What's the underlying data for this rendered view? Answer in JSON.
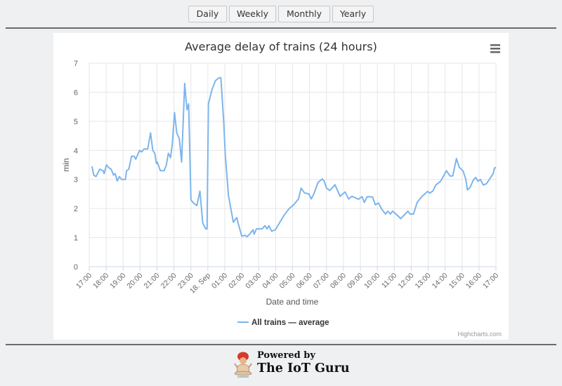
{
  "period_buttons": [
    {
      "label": "Daily"
    },
    {
      "label": "Weekly"
    },
    {
      "label": "Monthly"
    },
    {
      "label": "Yearly"
    }
  ],
  "chart_data": {
    "type": "line",
    "title": "Average delay of trains (24 hours)",
    "xlabel": "Date and time",
    "ylabel": "min",
    "ylim": [
      0,
      7
    ],
    "yticks": [
      "0",
      "1",
      "2",
      "3",
      "4",
      "5",
      "6",
      "7"
    ],
    "xticks": [
      "17:00",
      "18:00",
      "19:00",
      "20:00",
      "21:00",
      "22:00",
      "23:00",
      "18. Sep",
      "01:00",
      "02:00",
      "03:00",
      "04:00",
      "05:00",
      "06:00",
      "07:00",
      "08:00",
      "09:00",
      "10:00",
      "11:00",
      "12:00",
      "13:00",
      "14:00",
      "15:00",
      "16:00",
      "17:00"
    ],
    "grid": true,
    "legend_position": "bottom",
    "series": [
      {
        "name": "All trains — average",
        "color": "#7cb5ec",
        "points": [
          [
            "17:10",
            3.45
          ],
          [
            "17:16",
            3.15
          ],
          [
            "17:24",
            3.1
          ],
          [
            "17:37",
            3.35
          ],
          [
            "17:49",
            3.3
          ],
          [
            "17:53",
            3.2
          ],
          [
            "18:01",
            3.5
          ],
          [
            "18:10",
            3.4
          ],
          [
            "18:18",
            3.35
          ],
          [
            "18:26",
            3.15
          ],
          [
            "18:32",
            3.2
          ],
          [
            "18:39",
            2.95
          ],
          [
            "18:47",
            3.1
          ],
          [
            "18:55",
            3.0
          ],
          [
            "19:08",
            3.0
          ],
          [
            "19:12",
            3.3
          ],
          [
            "19:20",
            3.35
          ],
          [
            "19:30",
            3.8
          ],
          [
            "19:39",
            3.8
          ],
          [
            "19:45",
            3.7
          ],
          [
            "19:58",
            4.0
          ],
          [
            "20:06",
            3.95
          ],
          [
            "20:14",
            4.05
          ],
          [
            "20:27",
            4.05
          ],
          [
            "20:37",
            4.6
          ],
          [
            "20:45",
            4.0
          ],
          [
            "20:52",
            3.9
          ],
          [
            "20:58",
            3.55
          ],
          [
            "21:01",
            3.6
          ],
          [
            "21:12",
            3.3
          ],
          [
            "21:25",
            3.3
          ],
          [
            "21:33",
            3.5
          ],
          [
            "21:40",
            3.9
          ],
          [
            "21:48",
            3.75
          ],
          [
            "21:54",
            4.2
          ],
          [
            "22:02",
            5.3
          ],
          [
            "22:10",
            4.6
          ],
          [
            "22:19",
            4.4
          ],
          [
            "22:27",
            3.6
          ],
          [
            "22:38",
            6.3
          ],
          [
            "22:46",
            5.4
          ],
          [
            "22:52",
            5.6
          ],
          [
            "23:00",
            2.3
          ],
          [
            "23:08",
            2.2
          ],
          [
            "23:21",
            2.1
          ],
          [
            "23:32",
            2.6
          ],
          [
            "23:42",
            1.5
          ],
          [
            "23:52",
            1.3
          ],
          [
            "23:57",
            1.3
          ],
          [
            "00:02",
            5.6
          ],
          [
            "00:15",
            6.1
          ],
          [
            "00:27",
            6.4
          ],
          [
            "00:40",
            6.5
          ],
          [
            "00:46",
            6.5
          ],
          [
            "00:56",
            5.0
          ],
          [
            "01:02",
            3.8
          ],
          [
            "01:13",
            2.45
          ],
          [
            "01:30",
            1.53
          ],
          [
            "01:42",
            1.69
          ],
          [
            "01:50",
            1.4
          ],
          [
            "02:00",
            1.05
          ],
          [
            "02:12",
            1.08
          ],
          [
            "02:19",
            1.03
          ],
          [
            "02:28",
            1.12
          ],
          [
            "02:40",
            1.27
          ],
          [
            "02:44",
            1.12
          ],
          [
            "02:52",
            1.3
          ],
          [
            "03:12",
            1.3
          ],
          [
            "03:22",
            1.41
          ],
          [
            "03:30",
            1.3
          ],
          [
            "03:36",
            1.41
          ],
          [
            "03:46",
            1.22
          ],
          [
            "03:59",
            1.27
          ],
          [
            "04:15",
            1.53
          ],
          [
            "04:30",
            1.77
          ],
          [
            "04:48",
            2.0
          ],
          [
            "05:04",
            2.13
          ],
          [
            "05:21",
            2.33
          ],
          [
            "05:30",
            2.7
          ],
          [
            "05:42",
            2.54
          ],
          [
            "05:58",
            2.5
          ],
          [
            "06:06",
            2.33
          ],
          [
            "06:15",
            2.5
          ],
          [
            "06:30",
            2.9
          ],
          [
            "06:45",
            3.02
          ],
          [
            "06:52",
            2.94
          ],
          [
            "07:00",
            2.7
          ],
          [
            "07:12",
            2.62
          ],
          [
            "07:30",
            2.82
          ],
          [
            "07:48",
            2.42
          ],
          [
            "08:06",
            2.57
          ],
          [
            "08:18",
            2.33
          ],
          [
            "08:30",
            2.42
          ],
          [
            "08:53",
            2.32
          ],
          [
            "09:06",
            2.41
          ],
          [
            "09:14",
            2.21
          ],
          [
            "09:24",
            2.41
          ],
          [
            "09:43",
            2.4
          ],
          [
            "09:53",
            2.13
          ],
          [
            "10:04",
            2.19
          ],
          [
            "10:16",
            1.97
          ],
          [
            "10:29",
            1.81
          ],
          [
            "10:37",
            1.91
          ],
          [
            "10:46",
            1.81
          ],
          [
            "10:54",
            1.91
          ],
          [
            "11:06",
            1.81
          ],
          [
            "11:23",
            1.65
          ],
          [
            "11:48",
            1.91
          ],
          [
            "11:56",
            1.81
          ],
          [
            "12:08",
            1.81
          ],
          [
            "12:21",
            2.21
          ],
          [
            "12:37",
            2.41
          ],
          [
            "12:58",
            2.59
          ],
          [
            "13:06",
            2.53
          ],
          [
            "13:17",
            2.61
          ],
          [
            "13:27",
            2.81
          ],
          [
            "13:44",
            2.94
          ],
          [
            "14:05",
            3.3
          ],
          [
            "14:17",
            3.12
          ],
          [
            "14:27",
            3.12
          ],
          [
            "14:40",
            3.72
          ],
          [
            "14:50",
            3.42
          ],
          [
            "15:03",
            3.3
          ],
          [
            "15:13",
            3.02
          ],
          [
            "15:19",
            2.64
          ],
          [
            "15:28",
            2.72
          ],
          [
            "15:40",
            2.98
          ],
          [
            "15:48",
            3.07
          ],
          [
            "15:56",
            2.94
          ],
          [
            "16:05",
            3.0
          ],
          [
            "16:15",
            2.81
          ],
          [
            "16:26",
            2.85
          ],
          [
            "16:38",
            3.02
          ],
          [
            "16:50",
            3.2
          ],
          [
            "16:55",
            3.4
          ],
          [
            "17:00",
            3.4
          ]
        ]
      }
    ],
    "credits": "Highcharts.com",
    "menu_icon": "hamburger-menu-icon"
  },
  "footer": {
    "powered_by": "Powered by",
    "brand": "The IoT Guru",
    "logo_icon": "guru-logo-icon"
  }
}
